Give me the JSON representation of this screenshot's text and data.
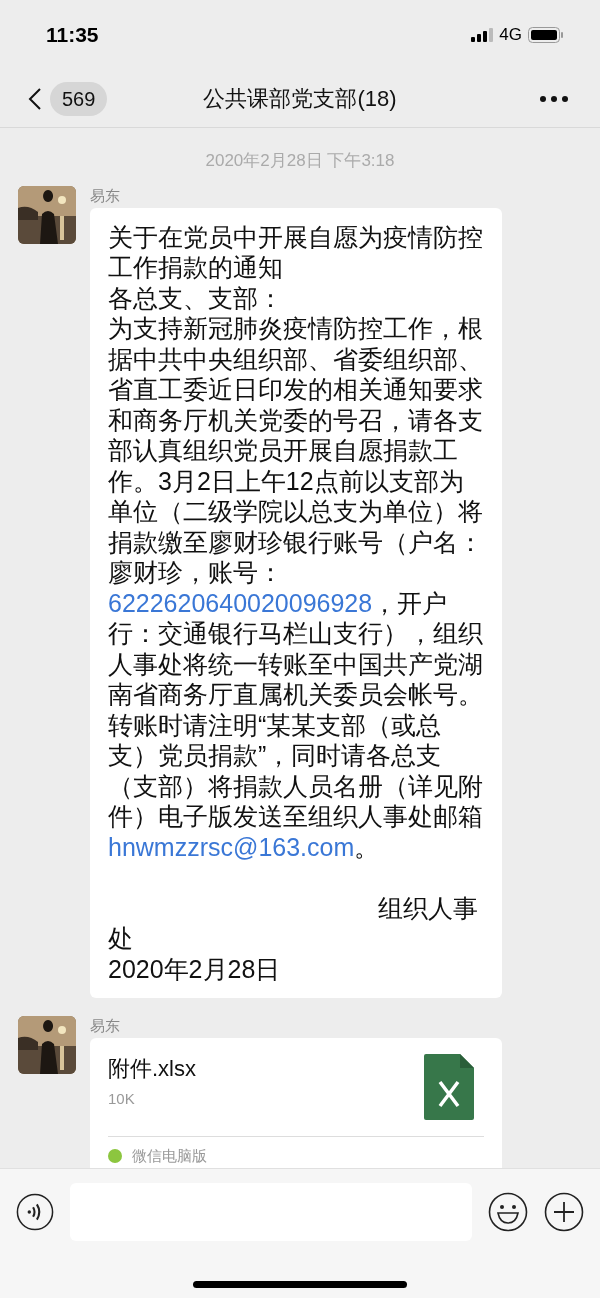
{
  "status_bar": {
    "time": "11:35",
    "network": "4G"
  },
  "header": {
    "back_count": "569",
    "title": "公共课部党支部(18)"
  },
  "timestamp": "2020年2月28日 下午3:18",
  "messages": [
    {
      "kind": "text",
      "sender": "易东",
      "title": "关于在党员中开展自愿为疫情防控工作捐款的通知",
      "salutation": "各总支、支部：",
      "body": [
        {
          "kind": "text",
          "text": "为支持新冠肺炎疫情防控工作，根据中共中央组织部、省委组织部、省直工委近日印发的相关通知要求和商务厅机关党委的号召，请各支部认真组织党员开展自愿捐款工作。3月2日上午12点前以支部为单位（二级学院以总支为单位）将捐款缴至廖财珍银行账号（户名：廖财珍，账号："
        },
        {
          "kind": "link",
          "text": "6222620640020096928"
        },
        {
          "kind": "text",
          "text": "，开户行：交通银行马栏山支行），组织人事处将统一转账至中国共产党湖南省商务厅直属机关委员会帐号。转账时请注明“某某支部（或总支）党员捐款”，同时请各总支（支部）将捐款人员名册（详见附件）电子版发送至组织人事处邮箱"
        },
        {
          "kind": "link",
          "text": "hnwmzzrsc@163.com"
        },
        {
          "kind": "text",
          "text": "。"
        }
      ],
      "signature": "组织人事处",
      "date": "2020年2月28日"
    },
    {
      "kind": "file",
      "sender": "易东",
      "file_name": "附件.xlsx",
      "file_size": "10K",
      "source": "微信电脑版"
    }
  ]
}
